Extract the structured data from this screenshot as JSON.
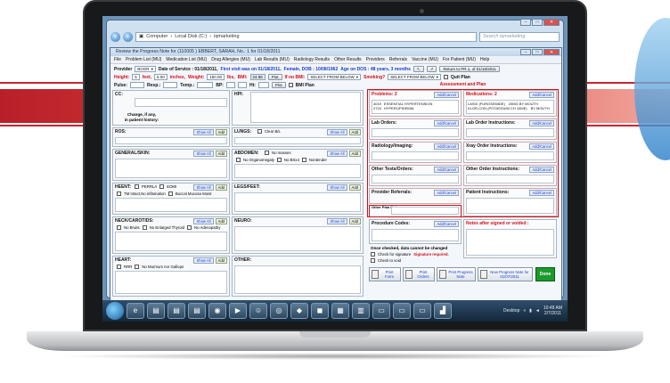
{
  "explorer": {
    "breadcrumb": [
      "Computer",
      "Local Disk (C:)",
      "iqmarketing"
    ],
    "search_placeholder": "Search iqmarketing"
  },
  "app": {
    "title": "Review the Progress Note for (110005 ) EBBERT, SARAH, No.: 1 for 01/18/2011",
    "menu": [
      "File",
      "Problem List (MU)",
      "Medication List (MU)",
      "Drug Allergies (MU)",
      "Lab Results (MU)",
      "Radiology Results",
      "Other Results",
      "Providers",
      "Referrals",
      "Vaccine (MU)",
      "For Patient (MU)",
      "Help"
    ],
    "provider_label": "Provider",
    "provider_value": "BOGR",
    "dos_label": "Date of Service : 01/18/2011,",
    "first_visit": "First visit was on 01/18/2011,",
    "patient_info": "Female, DOB : 10/08/1962",
    "age": "Age on DOS : 48 years, 3 months",
    "return_label": "Return to PR 1, of 01/18/2011",
    "height_label": "Height:",
    "height_ft": "5",
    "feet_label": "feet,",
    "height_in": "5.00",
    "inches_label": "inches,",
    "weight_label": "Weight:",
    "weight": "150.00",
    "lbs_label": "lbs,",
    "bmi_label": "BMI:",
    "bmi": "24.96",
    "plot_label": "Plot",
    "if_no_bmi": "If no BMI:",
    "select_below": "SELECT FROM BELOW",
    "smoking_label": "Smoking?",
    "smoking_value": "SELECT FROM BELOW",
    "quit_plan": "Quit Plan",
    "pulse_label": "Pulse:",
    "resp_label": "Resp.:",
    "temp_label": "Temp.:",
    "bp_label": "BP:",
    "ht_label": "Ht:",
    "bmi_plan": "BMI Plan"
  },
  "left": {
    "cc_label": "CC:",
    "hpi_label": "HPI:",
    "change_label": "Change, if any,",
    "history_label": "in patient history:",
    "show_all": "Show All",
    "add": "Add",
    "ros": "ROS:",
    "lungs": "LUNGS:",
    "lungs_opts": [
      "Clear B/L"
    ],
    "general": "GENERAL/SKIN:",
    "abdomen": "ABDOMEN:",
    "abdomen_opts": [
      "No masses",
      "No Organomegaly",
      "No BSx4",
      "Nontender"
    ],
    "heent": "HEENT:",
    "heent_opts": [
      "PERRLA",
      "EOMI",
      "TM Intact,No Inflamation",
      "Buccal Mucosa Moist"
    ],
    "legs": "LEGS/FEET:",
    "neck": "NECK/CAROTIDS:",
    "neck_opts": [
      "No Bruits",
      "No Enlarged Thyroid",
      "No Adenopathy"
    ],
    "neuro": "NEURO:",
    "heart": "HEART:",
    "heart_opts": [
      "RRR",
      "No Murmurs nor Gallops"
    ],
    "other": "OTHER:"
  },
  "right": {
    "header": "Assessment and Plan",
    "problems_label": "Problems: 2",
    "medications_label": "Medications: 2",
    "add_cancel": "Add/Cancel",
    "problems": [
      {
        "code": "4019",
        "name": "ESSENTIAL HYPERTENSION"
      },
      {
        "code": "2724",
        "name": "HYPERLIPIDEMIA"
      }
    ],
    "medications": [
      {
        "name": "LASIX (FUROSEMIDE)",
        "sig": "20MG BY MOUTH"
      },
      {
        "name": "KLOR-CON (POTASSIUM CH 10ME)",
        "sig": "BY MOUTH"
      }
    ],
    "lab_orders": "Lab Orders:",
    "lab_order_instr": "Lab Order Instructions:",
    "radiology": "Radiology/Imaging:",
    "xray_instr": "Xray Order Instructions:",
    "other_tests": "Other Tests/Orders:",
    "other_order_instr": "Other Order Instructions:",
    "provider_referrals": "Provider Referrals:",
    "patient_instructions": "Patient Instructions:",
    "other_plan_notes": [
      "Other",
      "Plan",
      "Notes"
    ],
    "procedure_codes": "Procedure Codes:",
    "notes_after": "Notes after signed or voided :",
    "once_checked": "Once checked, data cannot be changed",
    "check_signature": "Check for signature",
    "signature_required": "Signature required.",
    "check_void": "Check to void",
    "print_form": "Print Form",
    "print_orders": "Print Orders",
    "print_progress": "Print Progress Note",
    "new_progress": "New Progress Note for 01/07/2011",
    "done": "Done"
  },
  "taskbar": {
    "desktop_label": "Desktop",
    "time": "10:48 AM",
    "date": "2/7/2011"
  }
}
